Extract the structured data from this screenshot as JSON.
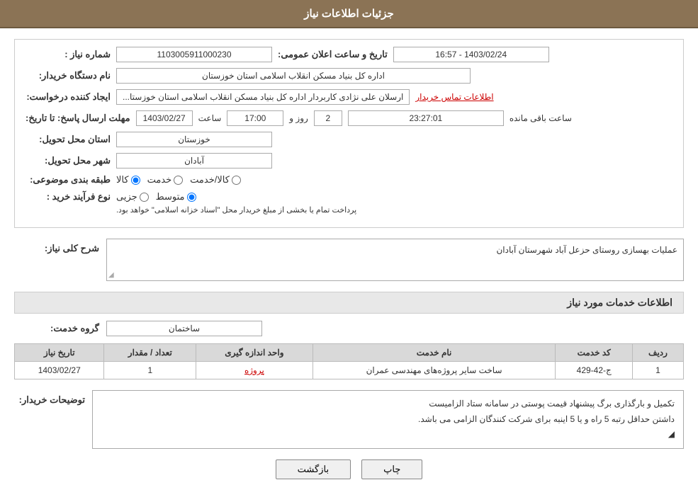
{
  "header": {
    "title": "جزئیات اطلاعات نیاز"
  },
  "fields": {
    "need_number_label": "شماره نیاز :",
    "need_number_value": "1103005911000230",
    "date_label": "تاریخ و ساعت اعلان عمومی:",
    "date_value": "1403/02/24 - 16:57",
    "buyer_label": "نام دستگاه خریدار:",
    "buyer_value": "اداره کل بنیاد مسکن انقلاب اسلامی استان خوزستان",
    "creator_label": "ایجاد کننده درخواست:",
    "creator_value": "ارسلان علی نژادی کاربردار اداره کل بنیاد مسکن انقلاب اسلامی استان خوزستا...",
    "creator_link": "اطلاعات تماس خریدار",
    "deadline_label": "مهلت ارسال پاسخ: تا تاریخ:",
    "deadline_date": "1403/02/27",
    "deadline_time_label": "ساعت",
    "deadline_time_value": "17:00",
    "deadline_day_label": "روز و",
    "deadline_days_value": "2",
    "deadline_remain_label": "ساعت باقی مانده",
    "deadline_remain_value": "23:27:01",
    "province_label": "استان محل تحویل:",
    "province_value": "خوزستان",
    "city_label": "شهر محل تحویل:",
    "city_value": "آبادان",
    "category_label": "طبقه بندی موضوعی:",
    "category_options": [
      {
        "label": "کالا",
        "value": "kala",
        "checked": true
      },
      {
        "label": "خدمت",
        "value": "khedmat",
        "checked": false
      },
      {
        "label": "کالا/خدمت",
        "value": "kala_khedmat",
        "checked": false
      }
    ],
    "process_label": "نوع فرآیند خرید :",
    "process_options": [
      {
        "label": "جزیی",
        "value": "jozi",
        "checked": false
      },
      {
        "label": "متوسط",
        "value": "motavasset",
        "checked": true
      }
    ],
    "process_desc": "پرداخت تمام یا بخشی از مبلغ خریدار محل \"اسناد خزانه اسلامی\" خواهد بود.",
    "need_desc_label": "شرح کلی نیاز:",
    "need_desc_value": "عملیات بهسازی روستای حزعل آباد شهرستان آبادان",
    "services_label": "اطلاعات خدمات مورد نیاز",
    "service_group_label": "گروه خدمت:",
    "service_group_value": "ساختمان",
    "table": {
      "headers": [
        "ردیف",
        "کد خدمت",
        "نام خدمت",
        "واحد اندازه گیری",
        "تعداد / مقدار",
        "تاریخ نیاز"
      ],
      "rows": [
        {
          "row": "1",
          "code": "ج-42-429",
          "name": "ساخت سایر پروژه‌های مهندسی عمران",
          "unit": "پروژه",
          "unit_link": true,
          "quantity": "1",
          "date": "1403/02/27"
        }
      ]
    },
    "buyer_desc_label": "توضیحات خریدار:",
    "buyer_desc_value": "تکمیل و بارگذاری برگ پیشنهاد قیمت پوستی در سامانه ستاد الزامیست\nداشتن حداقل رتبه 5 راه و یا  5  اینبه برای شرکت کنندگان الزامی می باشد.",
    "btn_print": "چاپ",
    "btn_back": "بازگشت"
  }
}
